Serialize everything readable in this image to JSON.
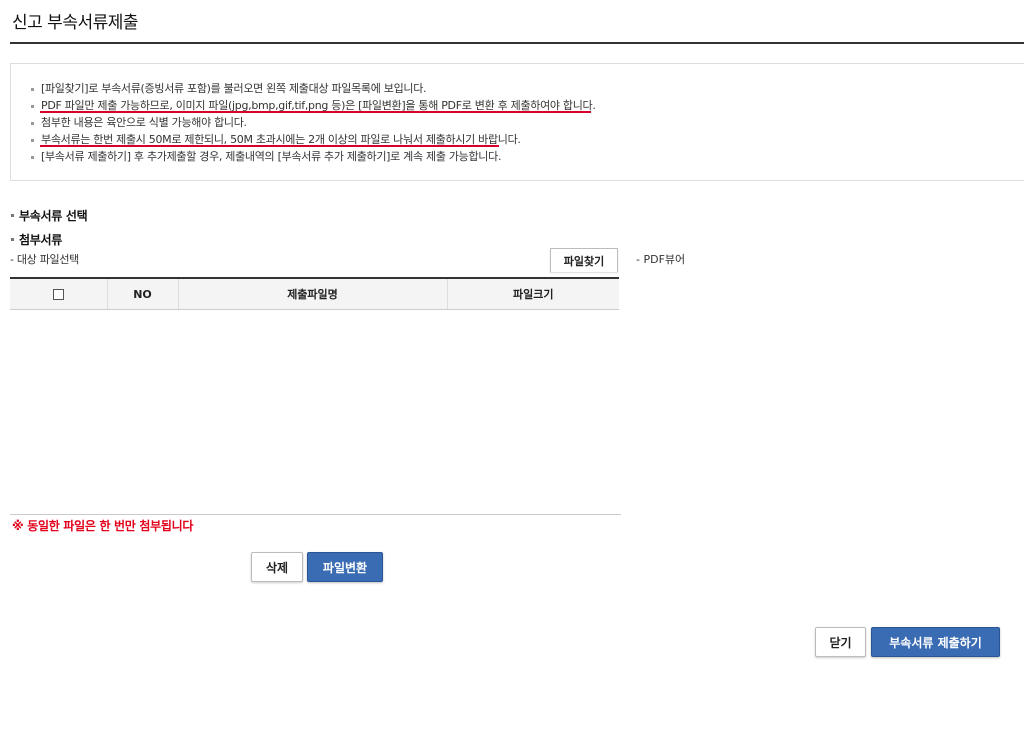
{
  "page": {
    "title": "신고 부속서류제출"
  },
  "notice": {
    "items": [
      "[파일찾기]로 부속서류(증빙서류 포함)를 불러오면 왼쪽 제출대상 파일목록에 보입니다.",
      "PDF 파일만 제출 가능하므로, 이미지 파일(jpg,bmp,gif,tif,png 등)은 [파일변환]을 통해 PDF로 변환 후 제출하여야 합니다.",
      "첨부한 내용은 육안으로 식별 가능해야 합니다.",
      "부속서류는 한번 제출시 50M로 제한되니, 50M 초과시에는 2개 이상의 파일로 나눠서 제출하시기 바랍니다.",
      "[부속서류 제출하기] 후 추가제출할 경우, 제출내역의 [부속서류 추가 제출하기]로 계속 제출 가능합니다."
    ],
    "highlight_color": "#d8002a"
  },
  "attachment": {
    "section_title": "부속서류 선택",
    "sub_title": "첨부서류",
    "target_label": "- 대상 파일선택",
    "find_button": "파일찾기",
    "pdf_viewer_label": "- PDF뷰어",
    "table": {
      "columns": [
        "",
        "NO",
        "제출파일명",
        "파일크기"
      ],
      "rows": []
    },
    "warning": "※ 동일한 파일은 한 번만 첨부됩니다",
    "delete_button": "삭제",
    "convert_button": "파일변환"
  },
  "footer": {
    "close_button": "닫기",
    "submit_button": "부속서류 제출하기"
  },
  "colors": {
    "accent_blue": "#3a6cb3",
    "warning_red": "#e2001a"
  }
}
